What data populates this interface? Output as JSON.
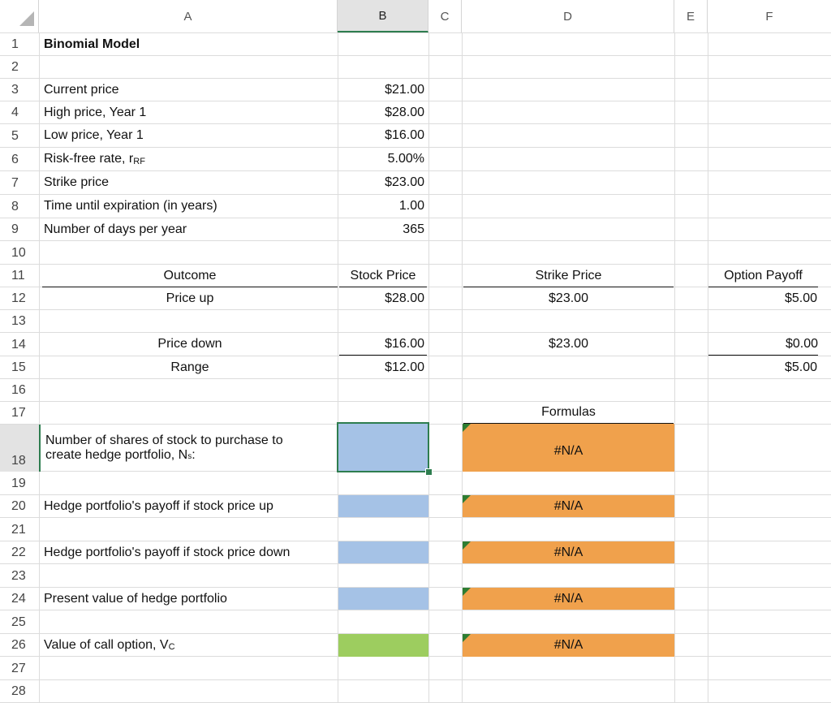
{
  "columns": [
    "A",
    "B",
    "C",
    "D",
    "E",
    "F"
  ],
  "selected_column": "B",
  "rows": [
    "1",
    "2",
    "3",
    "4",
    "5",
    "6",
    "7",
    "8",
    "9",
    "10",
    "11",
    "12",
    "13",
    "14",
    "15",
    "16",
    "17",
    "18",
    "19",
    "20",
    "21",
    "22",
    "23",
    "24",
    "25",
    "26",
    "27",
    "28"
  ],
  "title": "Binomial Model",
  "inputs": [
    {
      "label": "Current price",
      "value": "$21.00"
    },
    {
      "label": "High price, Year 1",
      "value": "$28.00"
    },
    {
      "label": "Low price, Year 1",
      "value": "$16.00"
    },
    {
      "label_main": "Risk-free rate, r",
      "label_sub": "RF",
      "value": "5.00%"
    },
    {
      "label": "Strike price",
      "value": "$23.00"
    },
    {
      "label": "Time until expiration (in years)",
      "value": "1.00"
    },
    {
      "label": "Number of days per year",
      "value": "365"
    }
  ],
  "outcome_table": {
    "headers": {
      "outcome": "Outcome",
      "stock_price": "Stock Price",
      "strike_price": "Strike Price",
      "option_payoff": "Option Payoff"
    },
    "up": {
      "label": "Price up",
      "stock": "$28.00",
      "strike": "$23.00",
      "payoff": "$5.00"
    },
    "down": {
      "label": "Price down",
      "stock": "$16.00",
      "strike": "$23.00",
      "payoff": "$0.00"
    },
    "range": {
      "label": "Range",
      "stock": "$12.00",
      "payoff": "$5.00"
    }
  },
  "formulas_header": "Formulas",
  "hedge": {
    "shares_line1": "Number of shares of stock to purchase to",
    "shares_line2_main": "create hedge portfolio, N",
    "shares_line2_sub": "s",
    "shares_line2_end": ":",
    "payoff_up": "Hedge portfolio's payoff if stock price up",
    "payoff_down": "Hedge portfolio's payoff if stock price down",
    "pv": "Present value of hedge portfolio",
    "call_main": "Value of call option, V",
    "call_sub": "C",
    "error": "#N/A"
  },
  "colors": {
    "input_blue": "#a5c2e6",
    "formula_orange": "#f0a14c",
    "result_green": "#9dcd5f",
    "selection_green": "#2e7d4f"
  }
}
